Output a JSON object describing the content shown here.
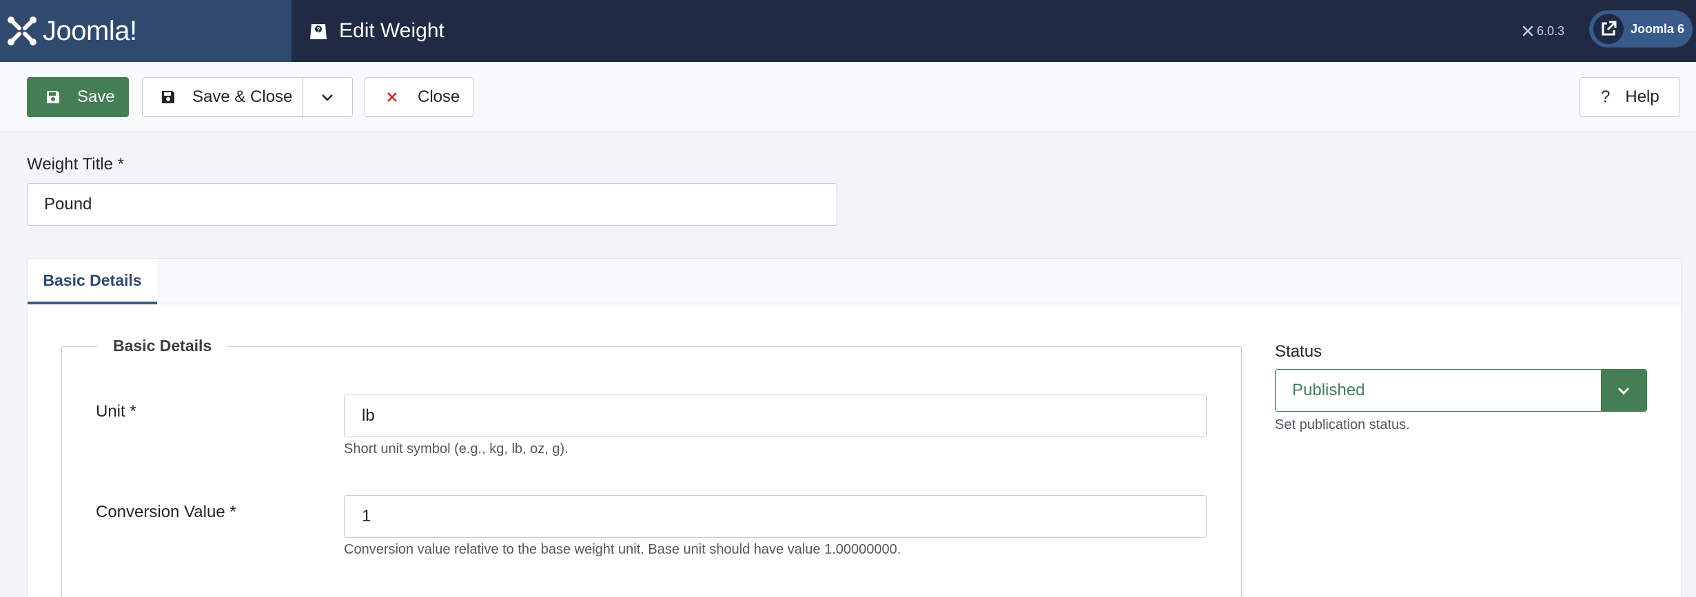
{
  "header": {
    "logo_text": "Joomla!",
    "page_title": "Edit Weight",
    "version": "6.0.3",
    "site_button_label": "Joomla 6"
  },
  "toolbar": {
    "save_label": "Save",
    "save_close_label": "Save & Close",
    "close_label": "Close",
    "help_label": "Help"
  },
  "form": {
    "title_label": "Weight Title *",
    "title_value": "Pound"
  },
  "tabs": [
    {
      "label": "Basic Details",
      "active": true
    }
  ],
  "basic_details": {
    "legend": "Basic Details",
    "unit": {
      "label": "Unit *",
      "value": "lb",
      "help": "Short unit symbol (e.g., kg, lb, oz, g)."
    },
    "conversion": {
      "label": "Conversion Value *",
      "value": "1",
      "help": "Conversion value relative to the base weight unit. Base unit should have value 1.00000000."
    }
  },
  "status": {
    "label": "Status",
    "value": "Published",
    "help": "Set publication status."
  },
  "colors": {
    "header_bg": "#1f2b45",
    "logo_bg": "#2f4a6e",
    "save_green": "#457d54",
    "close_red": "#c52827",
    "tab_accent": "#3a5a8c"
  }
}
